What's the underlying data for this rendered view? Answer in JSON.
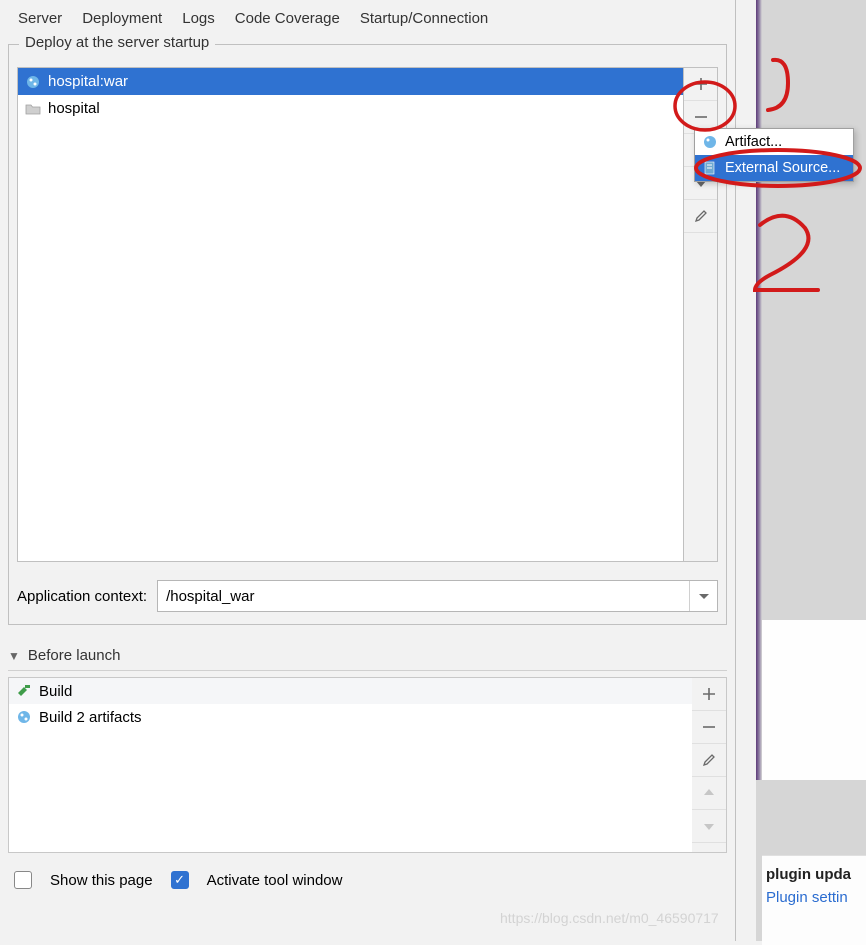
{
  "tabs": {
    "server": "Server",
    "deployment": "Deployment",
    "logs": "Logs",
    "coverage": "Code Coverage",
    "startup": "Startup/Connection"
  },
  "deploy": {
    "legend": "Deploy at the server startup",
    "items": [
      {
        "label": "hospital:war",
        "icon": "web-artifact-icon",
        "selected": true
      },
      {
        "label": "hospital",
        "icon": "folder-icon",
        "selected": false
      }
    ]
  },
  "context": {
    "label": "Application context:",
    "value": "/hospital_war"
  },
  "before_launch": {
    "title": "Before launch",
    "items": [
      {
        "label": "Build",
        "icon": "hammer-icon"
      },
      {
        "label": "Build 2 artifacts",
        "icon": "web-artifact-icon"
      }
    ]
  },
  "checks": {
    "show_this_page": {
      "label": "Show this page",
      "checked": false
    },
    "activate_tool_window": {
      "label": "Activate tool window",
      "checked": true
    }
  },
  "popup": {
    "artifact": "Artifact...",
    "external_source": "External Source..."
  },
  "right": {
    "plugin_title": "plugin upda",
    "plugin_link": "Plugin settin"
  },
  "annotations": {
    "one": "1",
    "two": "2"
  },
  "watermark": "https://blog.csdn.net/m0_46590717"
}
